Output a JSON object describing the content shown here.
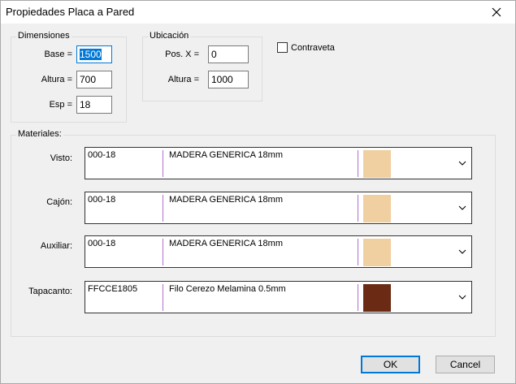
{
  "window": {
    "title": "Propiedades Placa a Pared"
  },
  "dimensiones": {
    "label": "Dimensiones",
    "base_label": "Base =",
    "base_value": "1500",
    "altura_label": "Altura =",
    "altura_value": "700",
    "esp_label": "Esp =",
    "esp_value": "18"
  },
  "ubicacion": {
    "label": "Ubicación",
    "posx_label": "Pos. X =",
    "posx_value": "0",
    "altura_label": "Altura =",
    "altura_value": "1000"
  },
  "contraveta": {
    "label": "Contraveta",
    "checked": false
  },
  "materiales": {
    "label": "Materiales:",
    "rows": [
      {
        "label": "Visto:",
        "code": "000-18",
        "desc": "MADERA GENERICA 18mm",
        "color": "#f0cfa0"
      },
      {
        "label": "Cajón:",
        "code": "000-18",
        "desc": "MADERA GENERICA 18mm",
        "color": "#f0cfa0"
      },
      {
        "label": "Auxiliar:",
        "code": "000-18",
        "desc": "MADERA GENERICA 18mm",
        "color": "#f0cfa0"
      },
      {
        "label": "Tapacanto:",
        "code": "FFCCE1805",
        "desc": "Filo Cerezo Melamina 0.5mm",
        "color": "#6b2a14"
      }
    ]
  },
  "buttons": {
    "ok": "OK",
    "cancel": "Cancel"
  }
}
